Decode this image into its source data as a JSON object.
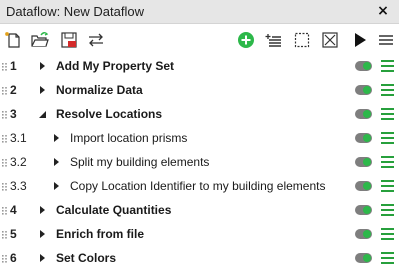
{
  "window": {
    "title": "Dataflow: New Dataflow",
    "close_icon": "×"
  },
  "toolbar": {
    "left_icons": [
      "new-icon",
      "open-folder-icon",
      "save-icon",
      "swap-icon"
    ],
    "right_icons": [
      "add-circle-icon",
      "add-list-icon",
      "select-box-icon",
      "delete-box-icon",
      "play-icon",
      "menu-lines-icon"
    ],
    "accent": "#2db84a"
  },
  "steps": [
    {
      "id": "1",
      "label": "Add My Property Set",
      "level": 0,
      "expanded": false,
      "enabled": true
    },
    {
      "id": "2",
      "label": "Normalize Data",
      "level": 0,
      "expanded": false,
      "enabled": true
    },
    {
      "id": "3",
      "label": "Resolve Locations",
      "level": 0,
      "expanded": true,
      "enabled": true
    },
    {
      "id": "3.1",
      "label": "Import location prisms",
      "level": 1,
      "expanded": false,
      "enabled": true
    },
    {
      "id": "3.2",
      "label": "Split my building elements",
      "level": 1,
      "expanded": false,
      "enabled": true
    },
    {
      "id": "3.3",
      "label": "Copy Location Identifier to my building elements",
      "level": 1,
      "expanded": false,
      "enabled": true
    },
    {
      "id": "4",
      "label": "Calculate Quantities",
      "level": 0,
      "expanded": false,
      "enabled": true
    },
    {
      "id": "5",
      "label": "Enrich from file",
      "level": 0,
      "expanded": false,
      "enabled": true
    },
    {
      "id": "6",
      "label": "Set Colors",
      "level": 0,
      "expanded": false,
      "enabled": true
    }
  ],
  "colors": {
    "toggle_on": "#2db84a",
    "menu": "#27a03c",
    "save_red": "#d42b2b"
  }
}
